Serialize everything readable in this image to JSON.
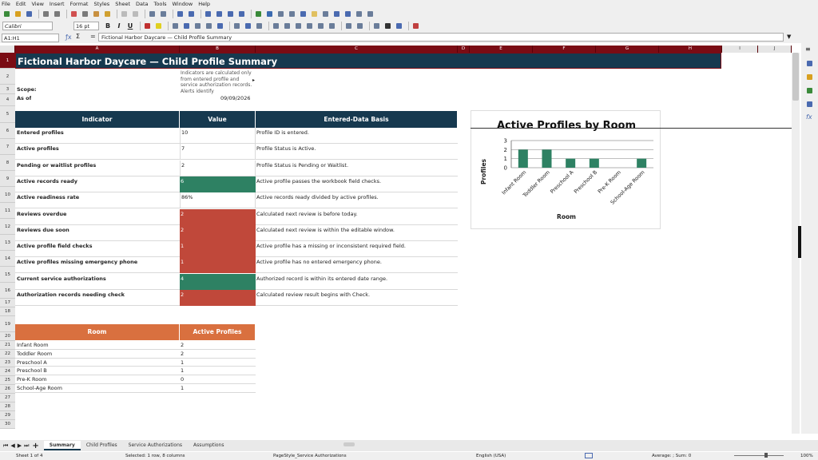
{
  "menu": [
    "File",
    "Edit",
    "View",
    "Insert",
    "Format",
    "Styles",
    "Sheet",
    "Data",
    "Tools",
    "Window",
    "Help"
  ],
  "toolbar": {
    "font_name": "Calibri",
    "font_size": "16 pt"
  },
  "formula": {
    "name_box": "A1:H1",
    "content": "Fictional Harbor Daycare — Child Profile Summary"
  },
  "columns": [
    "A",
    "B",
    "C",
    "D",
    "E",
    "F",
    "G",
    "H",
    "I",
    "J"
  ],
  "rows": [
    "1",
    "2",
    "3",
    "4",
    "5",
    "6",
    "7",
    "8",
    "9",
    "10",
    "11",
    "12",
    "13",
    "14",
    "15",
    "16",
    "17",
    "18",
    "19",
    "20",
    "21",
    "22",
    "23",
    "24",
    "25",
    "26",
    "27",
    "28",
    "29",
    "30"
  ],
  "sheet": {
    "title": "Fictional Harbor Daycare — Child Profile Summary",
    "scope_label": "Scope:",
    "scope_note": "Indicators are calculated only from entered profile and service authorization records. Alerts identify",
    "asof_label": "As of",
    "asof_value": "09/09/2026",
    "headers": {
      "indicator": "Indicator",
      "value": "Value",
      "basis": "Entered-Data Basis"
    },
    "indicators": [
      {
        "label": "Entered profiles",
        "value": "10",
        "basis": "Profile ID is entered.",
        "status": "none"
      },
      {
        "label": "Active profiles",
        "value": "7",
        "basis": "Profile Status is Active.",
        "status": "none"
      },
      {
        "label": "Pending or waitlist profiles",
        "value": "2",
        "basis": "Profile Status is Pending or Waitlist.",
        "status": "none"
      },
      {
        "label": "Active records ready",
        "value": "6",
        "basis": "Active profile passes the workbook field checks.",
        "status": "good"
      },
      {
        "label": "Active readiness rate",
        "value": "86%",
        "basis": "Active records ready divided by active profiles.",
        "status": "none"
      },
      {
        "label": "Reviews overdue",
        "value": "2",
        "basis": "Calculated next review is before today.",
        "status": "bad"
      },
      {
        "label": "Reviews due soon",
        "value": "2",
        "basis": "Calculated next review is within the editable window.",
        "status": "bad"
      },
      {
        "label": "Active profile field checks",
        "value": "1",
        "basis": "Active profile has a missing or inconsistent required field.",
        "status": "bad"
      },
      {
        "label": "Active profiles missing emergency phone",
        "value": "1",
        "basis": "Active profile has no entered emergency phone.",
        "status": "bad"
      },
      {
        "label": "Current service authorizations",
        "value": "4",
        "basis": "Authorized record is within its entered date range.",
        "status": "good"
      },
      {
        "label": "Authorization records needing check",
        "value": "2",
        "basis": "Calculated review result begins with Check.",
        "status": "bad"
      }
    ],
    "room_headers": {
      "room": "Room",
      "count": "Active Profiles"
    },
    "rooms": [
      {
        "room": "Infant Room",
        "count": "2"
      },
      {
        "room": "Toddler Room",
        "count": "2"
      },
      {
        "room": "Preschool A",
        "count": "1"
      },
      {
        "room": "Preschool B",
        "count": "1"
      },
      {
        "room": "Pre-K Room",
        "count": "0"
      },
      {
        "room": "School-Age Room",
        "count": "1"
      }
    ]
  },
  "chart_data": {
    "type": "bar",
    "title": "Active Profiles by Room",
    "xlabel": "Room",
    "ylabel": "Profiles",
    "categories": [
      "Infant Room",
      "Toddler Room",
      "Preschool A",
      "Preschool B",
      "Pre-K Room",
      "School-Age Room"
    ],
    "values": [
      2,
      2,
      1,
      1,
      0,
      1
    ],
    "ylim": [
      0,
      3
    ],
    "yticks": [
      "0",
      "1",
      "2",
      "3"
    ],
    "grid": true,
    "bar_color": "#2e8163"
  },
  "tabs": [
    "Summary",
    "Child Profiles",
    "Service Authorizations",
    "Assumptions"
  ],
  "status": {
    "sheet": "Sheet 1 of 4",
    "selection": "Selected: 1 row, 8 columns",
    "pagestyle": "PageStyle_Service Authorizations",
    "lang": "English (USA)",
    "average": "Average: ; Sum: 0",
    "zoom": "100%"
  },
  "colors": {
    "header": "#16394f",
    "accent": "#7a0c14",
    "good": "#2e8163",
    "bad": "#c0483a",
    "room_header": "#d9703f"
  }
}
